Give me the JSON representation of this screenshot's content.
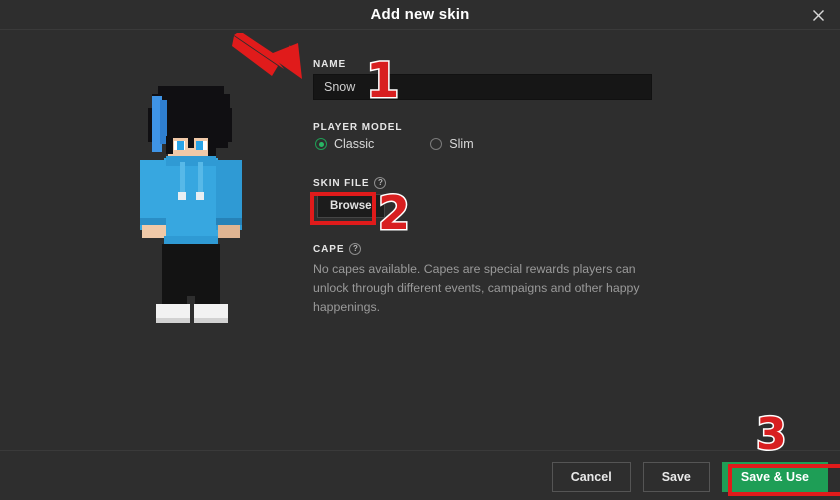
{
  "dialog": {
    "title": "Add new skin",
    "close_icon": "close-x-icon"
  },
  "form": {
    "name": {
      "label": "NAME",
      "value": "Snow",
      "placeholder": ""
    },
    "player_model": {
      "label": "PLAYER MODEL",
      "options": [
        {
          "label": "Classic",
          "selected": true
        },
        {
          "label": "Slim",
          "selected": false
        }
      ]
    },
    "skin_file": {
      "label": "SKIN FILE",
      "help_icon": "question-mark-icon",
      "browse_label": "Browse"
    },
    "cape": {
      "label": "CAPE",
      "help_icon": "question-mark-icon",
      "description": "No capes available. Capes are special rewards players can unlock through different events, campaigns and other happy happenings."
    }
  },
  "footer": {
    "cancel_label": "Cancel",
    "save_label": "Save",
    "save_and_use_label": "Save & Use"
  },
  "annotations": {
    "step1": "1",
    "step2": "2",
    "step3": "3",
    "arrow_icon": "red-arrow-icon"
  },
  "preview": {
    "alt": "minecraft-skin-preview"
  },
  "colors": {
    "background": "#2e2e2e",
    "input_background": "#161616",
    "accent_green": "#1e9e56",
    "radio_green": "#29b765",
    "annotation_red": "#e01b1b",
    "text_primary": "#e6e6e6",
    "text_muted": "#9a9a9a",
    "skin_hair": "#100f12",
    "skin_hoodie": "#37a7e0",
    "skin_pants": "#131313",
    "skin_shoes": "#f2f2f2",
    "skin_face": "#f0c9a8"
  }
}
